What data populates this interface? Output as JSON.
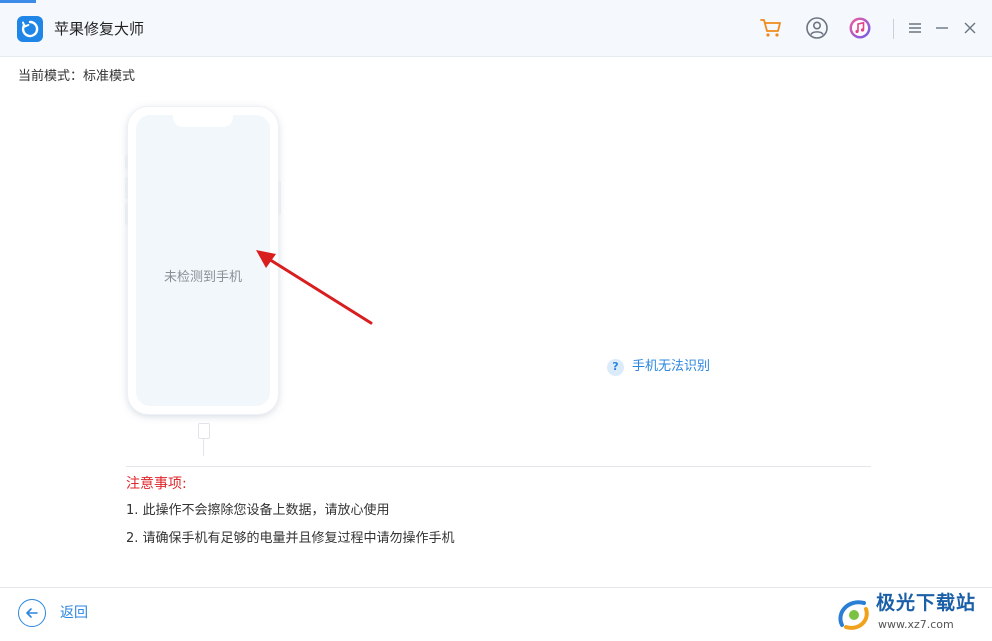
{
  "window": {
    "title": "苹果修复大师",
    "accent_color": "#1f86e8"
  },
  "toolbar": {
    "icons": [
      "cart-icon",
      "user-icon",
      "itunes-icon",
      "menu-icon",
      "minimize-icon",
      "close-icon"
    ]
  },
  "mode": {
    "text": "当前模式：标准模式"
  },
  "device": {
    "status_text": "未检测到手机"
  },
  "help": {
    "icon_glyph": "?",
    "link_text": "手机无法识别"
  },
  "notice": {
    "title": "注意事项:",
    "title_color": "#e0262a",
    "items": [
      "1. 此操作不会擦除您设备上数据，请放心使用",
      "2. 请确保手机有足够的电量并且修复过程中请勿操作手机"
    ]
  },
  "footer": {
    "back_label": "返回"
  },
  "watermark": {
    "brand": "极光下载站",
    "url": "www.xz7.com"
  }
}
